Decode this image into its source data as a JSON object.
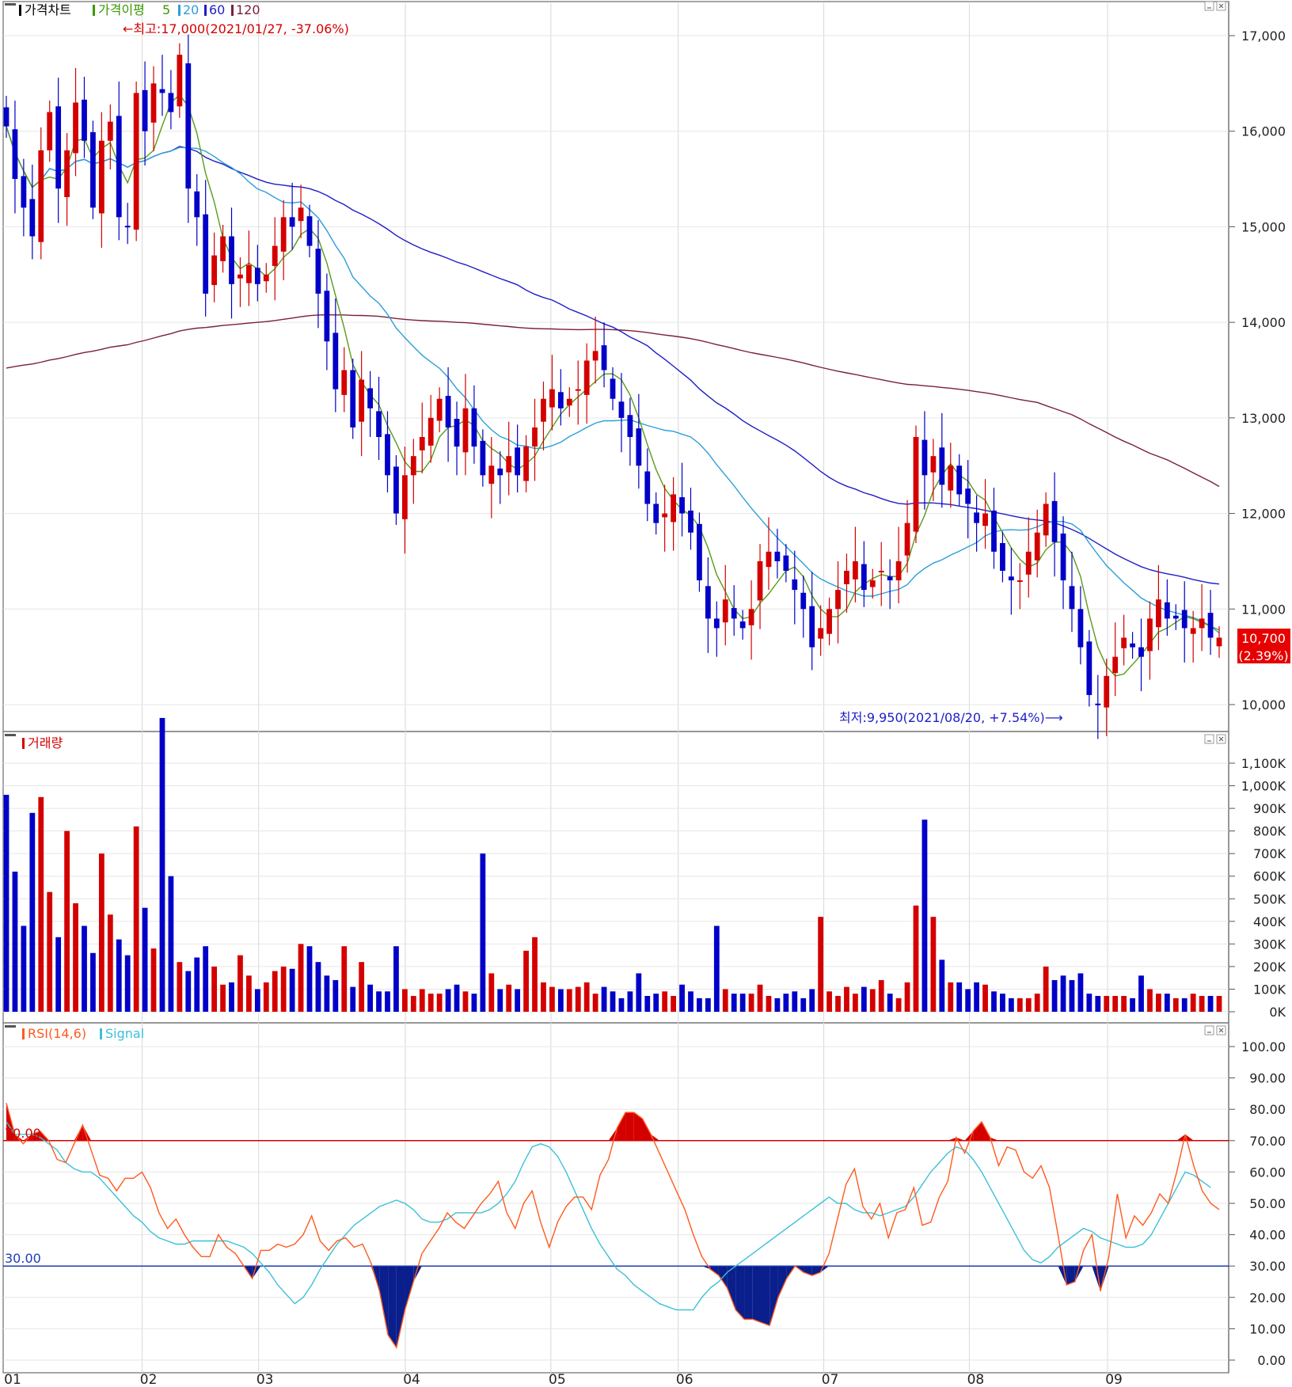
{
  "price_panel": {
    "legend": [
      "가격차트",
      "가격이평",
      "5",
      "20",
      "60",
      "120"
    ],
    "legend_colors": [
      "#000000",
      "#3a9a00",
      "#3a9a00",
      "#2c9fd9",
      "#1e1ec8",
      "#7a1f3a"
    ],
    "high_annotation": "←최고:17,000(2021/01/27, -37.06%)",
    "low_annotation": "최저:9,950(2021/08/20, +7.54%)⟶",
    "current_price": "10,700",
    "current_change": "(2.39%)",
    "y_ticks": [
      "17,000",
      "16,000",
      "15,000",
      "14,000",
      "13,000",
      "12,000",
      "11,000",
      "10,000"
    ]
  },
  "volume_panel": {
    "legend": "거래량",
    "y_ticks": [
      "1,100K",
      "1,000K",
      "900K",
      "800K",
      "700K",
      "600K",
      "500K",
      "400K",
      "300K",
      "200K",
      "100K",
      "0K"
    ]
  },
  "rsi_panel": {
    "legend_rsi": "RSI(14,6)",
    "legend_signal": "Signal",
    "upper_label": "70.00",
    "lower_label": "30.00",
    "y_ticks": [
      "100.00",
      "90.00",
      "80.00",
      "70.00",
      "60.00",
      "50.00",
      "40.00",
      "30.00",
      "20.00",
      "10.00",
      "0.00"
    ]
  },
  "x_ticks": [
    "01",
    "02",
    "03",
    "04",
    "05",
    "06",
    "07",
    "08",
    "09"
  ],
  "colors": {
    "up": "#d40000",
    "down": "#0000c8",
    "rsi": "#ff5a1e",
    "signal": "#3cc0d8",
    "ma5": "#5a9a1a",
    "ma20": "#2c9fd9",
    "ma60": "#1e1ec8",
    "ma120": "#7a1f3a",
    "overbought_line": "#d40000",
    "oversold_line": "#1e3cb4"
  },
  "chart_data": [
    {
      "type": "candlestick",
      "title": "가격차트",
      "period": "2021/01 - 2021/09",
      "ylim": [
        9800,
        17200
      ],
      "high": {
        "value": 17000,
        "date": "2021/01/27",
        "pct_from_current": -37.06
      },
      "low": {
        "value": 9950,
        "date": "2021/08/20",
        "pct_from_current": 7.54
      },
      "last_close": 10700,
      "last_change_pct": 2.39,
      "closes_approx": [
        16050,
        15500,
        15200,
        14900,
        15800,
        16200,
        15400,
        15800,
        16300,
        15900,
        15200,
        15900,
        16100,
        15100,
        15000,
        16400,
        16000,
        16500,
        16400,
        16200,
        16800,
        15400,
        15100,
        14300,
        14700,
        14900,
        14400,
        14500,
        14600,
        14400,
        14500,
        14800,
        15100,
        15000,
        15200,
        14800,
        14300,
        13800,
        13300,
        13500,
        12900,
        13400,
        13100,
        12800,
        12400,
        12000,
        12400,
        12600,
        12800,
        13000,
        13200,
        12900,
        12700,
        13100,
        12700,
        12400,
        12500,
        12400,
        12600,
        12400,
        12700,
        12900,
        13200,
        13300,
        13100,
        13200,
        13300,
        13600,
        13700,
        13500,
        13200,
        13000,
        12800,
        12500,
        12100,
        11900,
        12000,
        12200,
        12000,
        11800,
        11300,
        10900,
        10800,
        11100,
        10900,
        10800,
        11000,
        11500,
        11600,
        11500,
        11400,
        11200,
        11000,
        10600,
        10800,
        11000,
        11200,
        11400,
        11500,
        11200,
        11300,
        11400,
        11300,
        11500,
        11900,
        12800,
        12400,
        12600,
        12300,
        12500,
        12200,
        12100,
        11900,
        12000,
        11600,
        11400,
        11300,
        11300,
        11600,
        11800,
        12100,
        11700,
        11300,
        11000,
        10600,
        10100,
        10000,
        10300,
        10500,
        10700,
        10600,
        10500,
        10900,
        11100,
        10900,
        10900,
        10800,
        10800,
        10900,
        10700,
        10700
      ]
    },
    {
      "type": "bar",
      "title": "거래량",
      "unit": "K",
      "ylim": [
        0,
        1150
      ],
      "values_approx": [
        960,
        620,
        380,
        880,
        950,
        530,
        330,
        800,
        480,
        380,
        260,
        700,
        430,
        320,
        250,
        820,
        460,
        280,
        1300,
        600,
        220,
        180,
        240,
        290,
        200,
        120,
        130,
        250,
        160,
        100,
        130,
        180,
        200,
        190,
        300,
        290,
        220,
        160,
        140,
        290,
        110,
        220,
        120,
        90,
        90,
        290,
        100,
        70,
        100,
        80,
        80,
        100,
        120,
        90,
        80,
        700,
        170,
        100,
        120,
        100,
        270,
        330,
        130,
        110,
        100,
        100,
        110,
        130,
        80,
        110,
        90,
        60,
        90,
        170,
        70,
        80,
        90,
        70,
        120,
        90,
        60,
        60,
        380,
        100,
        80,
        80,
        80,
        120,
        70,
        60,
        80,
        90,
        60,
        100,
        420,
        90,
        70,
        110,
        80,
        110,
        100,
        140,
        80,
        60,
        130,
        470,
        850,
        420,
        230,
        130,
        130,
        100,
        130,
        120,
        90,
        80,
        60,
        60,
        60,
        80,
        200,
        140,
        160,
        140,
        170,
        80,
        70,
        70,
        70,
        70,
        60,
        160,
        100,
        80,
        80,
        60,
        60,
        80,
        70,
        70,
        70
      ]
    },
    {
      "type": "line",
      "title": "RSI(14,6)",
      "ylim": [
        0,
        100
      ],
      "reference_lines": [
        70,
        30
      ],
      "series": [
        {
          "name": "RSI(14,6)",
          "values": [
            82,
            72,
            69,
            72,
            73,
            70,
            64,
            63,
            69,
            75,
            67,
            59,
            58,
            54,
            58,
            58,
            60,
            55,
            47,
            42,
            45,
            40,
            36,
            33,
            33,
            40,
            36,
            34,
            30,
            26,
            35,
            35,
            37,
            36,
            37,
            40,
            46,
            38,
            35,
            38,
            39,
            36,
            37,
            31,
            22,
            8,
            4,
            16,
            25,
            34,
            38,
            42,
            47,
            44,
            42,
            46,
            50,
            53,
            57,
            47,
            42,
            50,
            54,
            44,
            36,
            44,
            49,
            52,
            52,
            48,
            59,
            64,
            74,
            79,
            79,
            77,
            72,
            66,
            60,
            54,
            48,
            40,
            33,
            29,
            27,
            23,
            16,
            13,
            13,
            12,
            11,
            20,
            26,
            30,
            28,
            27,
            28,
            34,
            45,
            56,
            61,
            49,
            45,
            50,
            39,
            47,
            48,
            55,
            43,
            44,
            52,
            57,
            71,
            66,
            73,
            76,
            71,
            62,
            68,
            67,
            60,
            58,
            62,
            55,
            40,
            24,
            25,
            35,
            40,
            22,
            33,
            53,
            39,
            46,
            43,
            47,
            53,
            50,
            60,
            72,
            62,
            54,
            50,
            48
          ]
        },
        {
          "name": "Signal",
          "values": [
            76,
            72,
            72,
            72,
            71,
            69,
            67,
            63,
            61,
            60,
            60,
            58,
            55,
            52,
            49,
            46,
            44,
            41,
            39,
            38,
            37,
            37,
            38,
            38,
            38,
            38,
            38,
            37,
            36,
            34,
            31,
            28,
            24,
            21,
            18,
            20,
            24,
            29,
            33,
            37,
            40,
            43,
            45,
            47,
            49,
            50,
            51,
            50,
            48,
            45,
            44,
            44,
            45,
            47,
            47,
            47,
            47,
            48,
            50,
            53,
            57,
            63,
            68,
            69,
            68,
            65,
            60,
            54,
            48,
            42,
            37,
            33,
            29,
            27,
            24,
            22,
            20,
            18,
            17,
            16,
            16,
            16,
            20,
            23,
            25,
            28,
            30,
            32,
            34,
            36,
            38,
            40,
            42,
            44,
            46,
            48,
            50,
            52,
            50,
            50,
            48,
            47,
            47,
            46,
            47,
            48,
            49,
            52,
            56,
            60,
            63,
            66,
            68,
            67,
            64,
            60,
            55,
            50,
            45,
            40,
            35,
            32,
            31,
            33,
            36,
            38,
            40,
            42,
            41,
            39,
            38,
            37,
            36,
            36,
            37,
            40,
            45,
            50,
            55,
            60,
            59,
            57,
            55
          ]
        }
      ]
    }
  ]
}
